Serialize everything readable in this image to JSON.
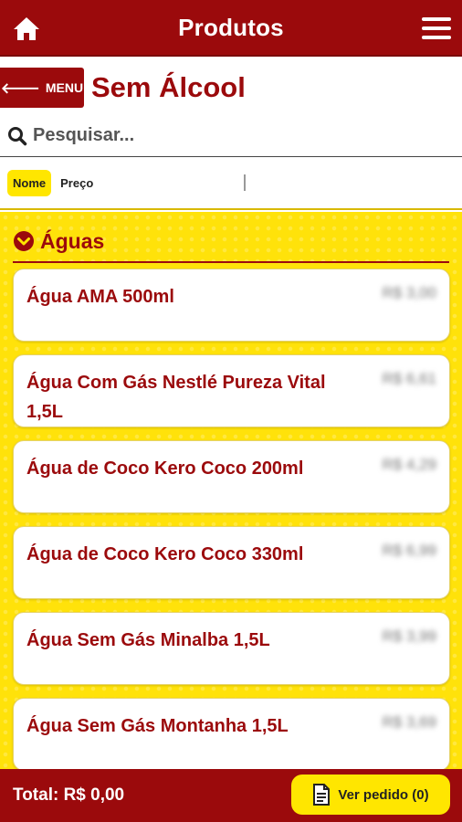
{
  "header": {
    "title": "Produtos"
  },
  "category": {
    "menu_label": "MENU",
    "title": "Sem Álcool"
  },
  "search": {
    "placeholder": "Pesquisar..."
  },
  "sort": {
    "options": [
      "Nome",
      "Preço"
    ],
    "active": "Nome"
  },
  "group": {
    "title": "Águas"
  },
  "products": [
    {
      "name": "Água AMA 500ml",
      "price": "R$ 3,00"
    },
    {
      "name": "Água Com Gás Nestlé Pureza Vital 1,5L",
      "price": "R$ 6,61"
    },
    {
      "name": "Água de Coco Kero Coco 200ml",
      "price": "R$ 4,29"
    },
    {
      "name": "Água de Coco Kero Coco 330ml",
      "price": "R$ 6,99"
    },
    {
      "name": "Água Sem Gás Minalba 1,5L",
      "price": "R$ 3,99"
    },
    {
      "name": "Água Sem Gás Montanha 1,5L",
      "price": "R$ 3,69"
    }
  ],
  "footer": {
    "total": "Total: R$ 0,00",
    "order_button": "Ver pedido (0)"
  },
  "colors": {
    "primary": "#9b0a0c",
    "accent": "#ffe600"
  },
  "icons": {
    "home": "home-icon",
    "menu": "hamburger-icon",
    "back": "arrow-left-icon",
    "search": "search-icon",
    "expand": "chevron-down-circle-icon",
    "order": "document-icon"
  }
}
